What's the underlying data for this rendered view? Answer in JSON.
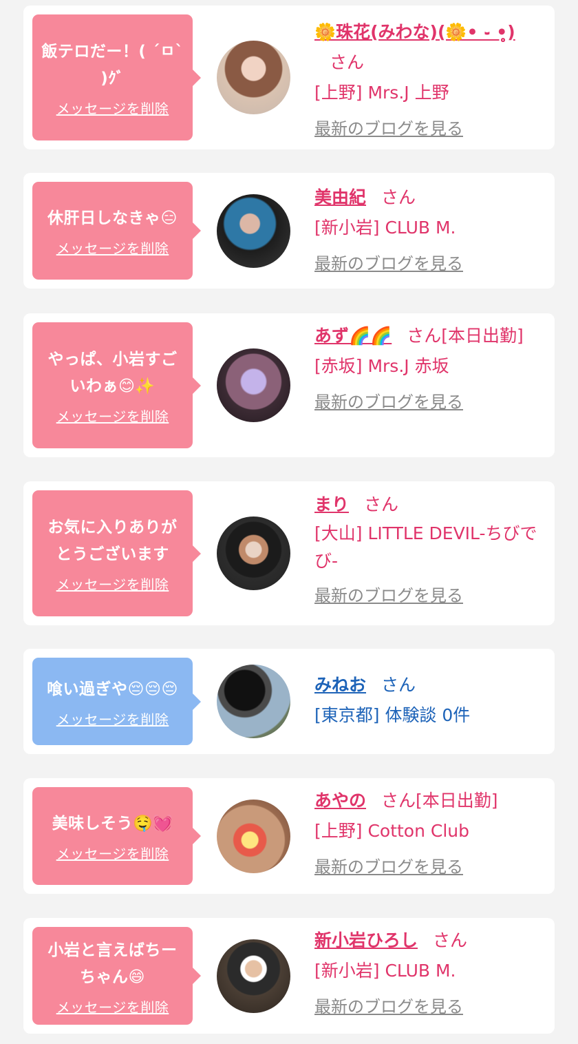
{
  "theme": {
    "accent_pink": "#e0346a",
    "bubble_pink": "#f7889a",
    "bubble_blue": "#8bb8f2",
    "link_gray": "#8a8a8a",
    "accent_blue": "#1d63b8"
  },
  "delete_label": "メッセージを削除",
  "blog_label": "最新のブログを見る",
  "cards": [
    {
      "message": "飯テロだー！( ´ㅁ` )ｸﾞ",
      "name": "🌼珠花(みわな)(🌼• ֊ •̥̥̥̥̥)",
      "san": "さん",
      "shop": "[上野] Mrs.J 上野",
      "blog": true
    },
    {
      "message": "休肝日しなきゃ😑",
      "name": "美由紀",
      "san": "さん",
      "shop": "[新小岩] CLUB M.",
      "blog": true
    },
    {
      "message": "やっぱ、小岩すごいわぁ😊✨",
      "name": "あず🌈🌈",
      "san": "さん[本日出勤]",
      "shop": "[赤坂] Mrs.J 赤坂",
      "blog": true
    },
    {
      "message": "お気に入りありがとうございます",
      "name": "まり",
      "san": "さん",
      "shop": "[大山] LITTLE DEVIL-ちびでび-",
      "blog": true
    },
    {
      "message": "喰い過ぎや😔😔😔",
      "name": "みねお",
      "san": "さん",
      "shop": "[東京都] 体験談 0件",
      "blog": false
    },
    {
      "message": "美味しそう🤤💓",
      "name": "あやの",
      "san": "さん[本日出勤]",
      "shop": "[上野] Cotton Club",
      "blog": true
    },
    {
      "message": "小岩と言えばちーちゃん😄",
      "name": "新小岩ひろし",
      "san": "さん",
      "shop": "[新小岩] CLUB M.",
      "blog": true
    }
  ]
}
